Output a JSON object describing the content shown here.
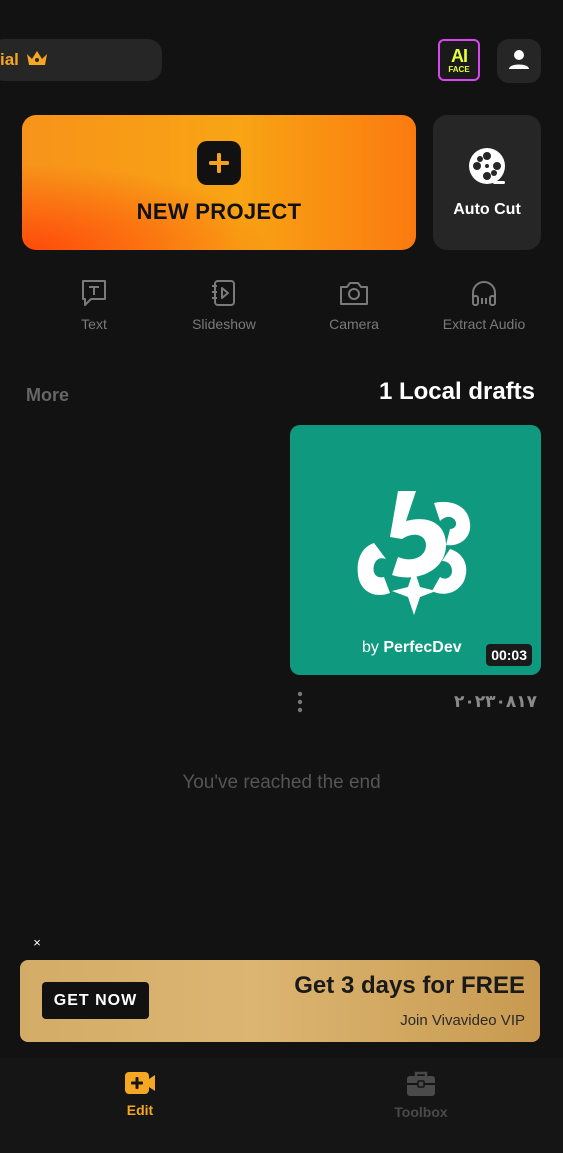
{
  "header": {
    "trial_label": "ial",
    "ai_face": {
      "line1": "AI",
      "line2": "FACE"
    }
  },
  "actions": {
    "new_project": "NEW PROJECT",
    "auto_cut": "Auto Cut"
  },
  "tools": [
    {
      "label": "Text",
      "icon": "text-icon"
    },
    {
      "label": "Slideshow",
      "icon": "slideshow-icon"
    },
    {
      "label": "Camera",
      "icon": "camera-icon"
    },
    {
      "label": "Extract Audio",
      "icon": "headphones-icon"
    }
  ],
  "drafts": {
    "more_label": "More",
    "title": "1 Local drafts",
    "items": [
      {
        "by": "by ",
        "brand": "PerfecDev",
        "duration": "00:03",
        "date": "٢٠٢٣٠٨١٧"
      }
    ],
    "end_text": "You've reached the end"
  },
  "promo": {
    "close": "×",
    "button": "GET NOW",
    "title": "Get 3 days for FREE",
    "subtitle": "Join Vivavideo VIP"
  },
  "tabs": [
    {
      "label": "Edit",
      "active": true
    },
    {
      "label": "Toolbox",
      "active": false
    }
  ],
  "colors": {
    "accent": "#f5a623",
    "background": "#121212",
    "card": "#262626",
    "draft_bg": "#0f9a80"
  }
}
